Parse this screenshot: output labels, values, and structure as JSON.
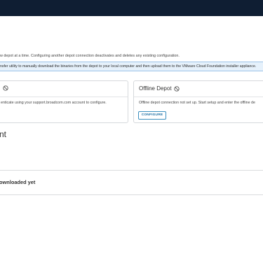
{
  "intro_text": "w depot at a time. Configuring another depot connection deactivates and deletes any existing configuration.",
  "info_banner": "nsfer utility to manually download the binaries from the depot to your local computer and then upload them to the VMware Cloud Foundation installer appliance.",
  "online_depot": {
    "title": "",
    "status_icon": "ban-icon",
    "description": "enticate using your support.broadcom.com account to configure."
  },
  "offline_depot": {
    "title": "Offline Depot",
    "status_icon": "ban-icon",
    "description": "Offline depot connection not set up. Start setup and enter the offline de",
    "configure_label": "CONFIGURE"
  },
  "section_heading": "nt",
  "download_status": "ownloaded yet",
  "colors": {
    "topbar": "#0f1e33",
    "info_bg": "#e6f1fb",
    "button_text": "#1b6ea3"
  }
}
